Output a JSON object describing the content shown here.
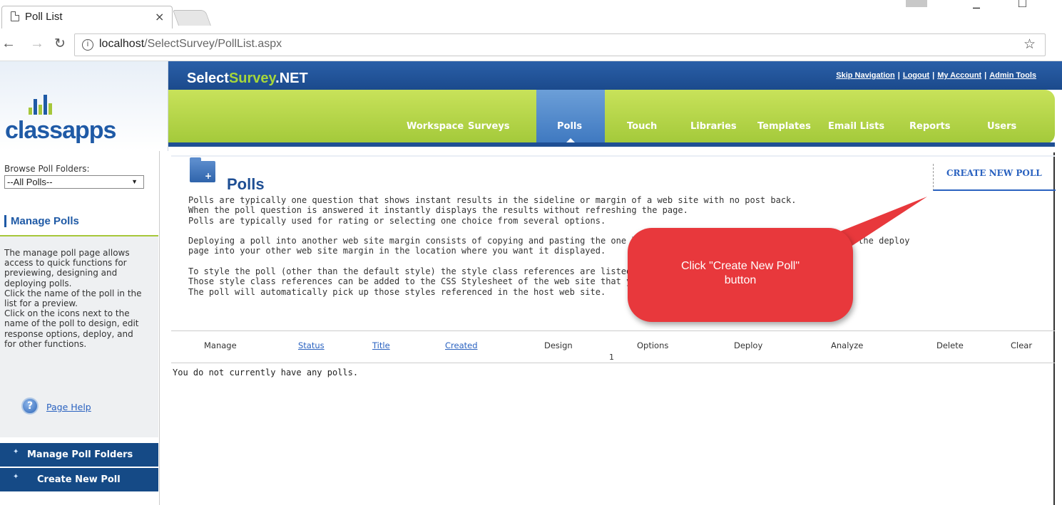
{
  "browser": {
    "tab_title": "Poll List",
    "tab_close": "×",
    "url_host": "localhost",
    "url_path": "/SelectSurvey/PollList.aspx",
    "info_glyph": "i"
  },
  "header": {
    "brand_prefix": "Select",
    "brand_accent": "Survey",
    "brand_suffix": ".NET",
    "links": [
      "Skip Navigation",
      "Logout",
      "My Account",
      "Admin Tools"
    ],
    "logo_text": "classapps"
  },
  "nav": {
    "tabs": [
      "Workspace",
      "Surveys",
      "Polls",
      "Touch",
      "Libraries",
      "Templates",
      "Email Lists",
      "Reports",
      "Users"
    ],
    "active": "Polls"
  },
  "sidebar": {
    "browse_label": "Browse Poll Folders:",
    "browse_value": "--All Polls--",
    "manage_title": "Manage Polls",
    "manage_desc": "The manage poll page allows access to quick functions for previewing, designing and deploying polls.\nClick the name of the poll in the list for a preview.\nClick on the icons next to the name of the poll to design, edit response options, deploy, and for other functions.",
    "help_link": "Page Help",
    "buttons": [
      "Manage Poll Folders",
      "Create New Poll"
    ]
  },
  "main": {
    "title": "Polls",
    "create_button": "CREATE NEW POLL",
    "paragraphs": [
      "Polls are typically one question that shows instant results in the sideline or margin of a web site with no post back.\nWhen the poll question is answered it instantly displays the results without refreshing the page.\nPolls are typically used for rating or selecting one choice from several options.",
      "Deploying a poll into another web site margin consists of copying and pasting the one line                                   from the deploy\npage into your other web site margin in the location where you want it displayed.",
      "To style the poll (other than the default style) the style class references are listed on the\nThose style class references can be added to the CSS Stylesheet of the web site that yo\nThe poll will automatically pick up those styles referenced in the host web site."
    ],
    "columns": [
      "Manage",
      "Status",
      "Title",
      "Created",
      "Design",
      "Options",
      "Deploy",
      "Analyze",
      "Delete",
      "Clear"
    ],
    "page_number": "1",
    "empty_message": "You do not currently have any polls."
  },
  "callout": {
    "text": "Click \"Create New Poll\" button"
  },
  "colors": {
    "brand_blue": "#1f4f94",
    "nav_green": "#a3c93a",
    "callout_red": "#e8383c",
    "link_blue": "#2a62c0"
  }
}
